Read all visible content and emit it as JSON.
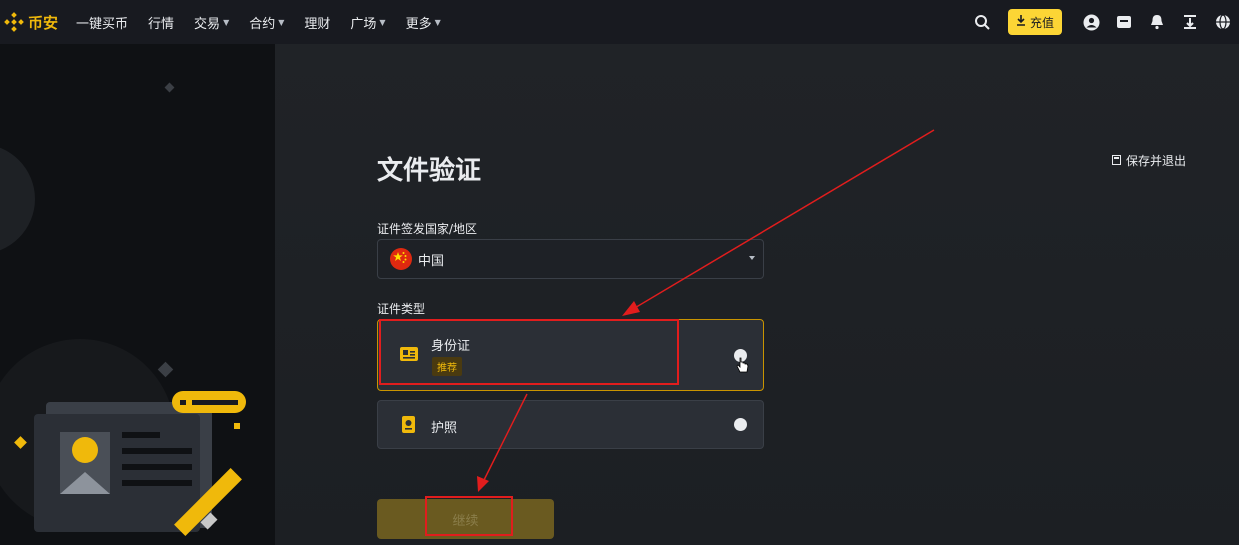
{
  "brand": {
    "name": "币安",
    "color": "#f0b90b"
  },
  "nav": {
    "items": [
      {
        "label": "一键买币",
        "dropdown": false
      },
      {
        "label": "行情",
        "dropdown": false
      },
      {
        "label": "交易",
        "dropdown": true
      },
      {
        "label": "合约",
        "dropdown": true
      },
      {
        "label": "理财",
        "dropdown": false
      },
      {
        "label": "广场",
        "dropdown": true
      },
      {
        "label": "更多",
        "dropdown": true
      }
    ],
    "deposit_label": "充值",
    "icons": [
      "search-icon",
      "user-icon",
      "wallet-icon",
      "bell-icon",
      "download-icon",
      "globe-icon"
    ]
  },
  "page": {
    "title": "文件验证",
    "save_exit_label": "保存并退出",
    "country_label": "证件签发国家/地区",
    "country_value": "中国",
    "doc_type_label": "证件类型",
    "options": [
      {
        "title": "身份证",
        "badge": "推荐",
        "selected": true,
        "icon": "id-card-icon"
      },
      {
        "title": "护照",
        "badge": "",
        "selected": false,
        "icon": "passport-icon"
      }
    ],
    "continue_label": "继续"
  },
  "colors": {
    "accent": "#fcd535",
    "annotation": "#e11d1d"
  }
}
